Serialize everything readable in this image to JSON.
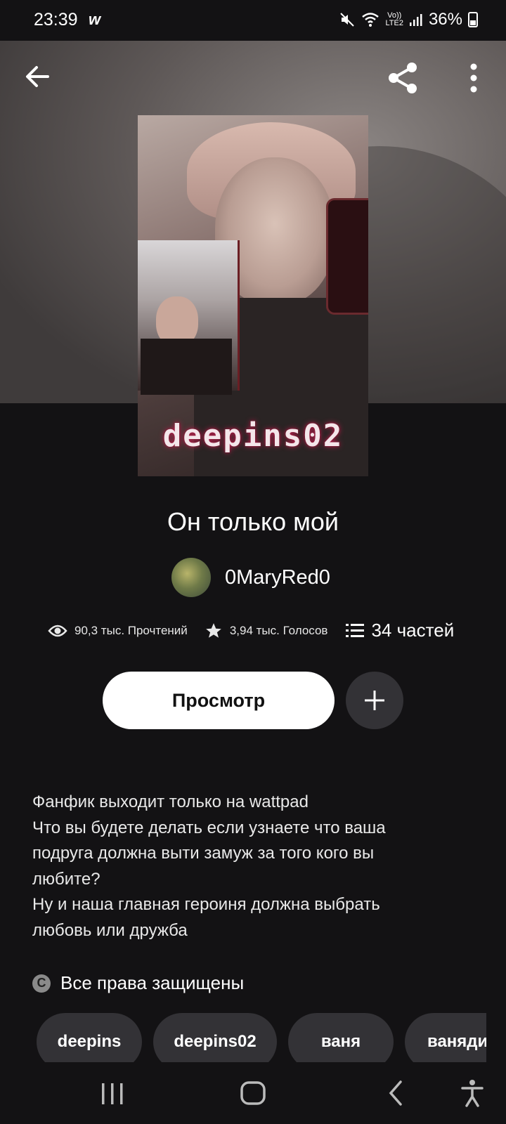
{
  "status_bar": {
    "time": "23:39",
    "app_glyph": "w",
    "network_top": "Vo))",
    "network_bottom": "LTE2",
    "battery": "36%"
  },
  "story": {
    "cover_text": "deepins02",
    "title": "Он только мой",
    "author": "0MaryRed0",
    "reads": "90,3 тыс. Прочтений",
    "votes": "3,94 тыс. Голосов",
    "parts": "34 частей",
    "read_button": "Просмотр",
    "description": [
      "Фанфик выходит только на wattpad",
      "Что вы будете делать если узнаете что ваша",
      "подруга должна выти замуж за того кого вы",
      "любите?",
      "Ну и наша главная героиня должна выбрать",
      "любовь или дружба"
    ],
    "copyright": "Все права защищены",
    "tags": [
      "deepins",
      "deepins02",
      "ваня",
      "ваняди"
    ]
  },
  "icons": {
    "back": "arrow-left-icon",
    "share": "share-icon",
    "more": "more-vertical-icon",
    "eye": "eye-icon",
    "star": "star-icon",
    "list": "list-icon",
    "plus": "plus-icon",
    "copyright": "copyright-icon"
  },
  "colors": {
    "background": "#131214",
    "button_primary": "#ffffff",
    "button_secondary": "#333236"
  }
}
